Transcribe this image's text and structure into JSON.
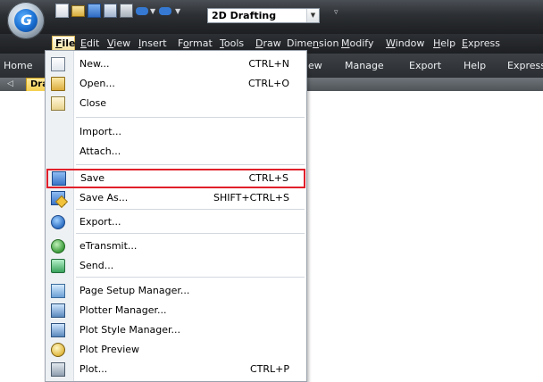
{
  "title_bar": {
    "app_logo": "G",
    "workspace": "2D Drafting"
  },
  "menu_bar": {
    "items": [
      {
        "id": "file",
        "pre": "",
        "u": "F",
        "post": "ile"
      },
      {
        "id": "edit",
        "pre": "",
        "u": "E",
        "post": "dit"
      },
      {
        "id": "view",
        "pre": "",
        "u": "V",
        "post": "iew"
      },
      {
        "id": "insert",
        "pre": "",
        "u": "I",
        "post": "nsert"
      },
      {
        "id": "format",
        "pre": "F",
        "u": "o",
        "post": "rmat"
      },
      {
        "id": "tools",
        "pre": "",
        "u": "T",
        "post": "ools"
      },
      {
        "id": "draw",
        "pre": "",
        "u": "D",
        "post": "raw"
      },
      {
        "id": "dimension",
        "pre": "Dime",
        "u": "n",
        "post": "sion"
      },
      {
        "id": "modify",
        "pre": "",
        "u": "M",
        "post": "odify"
      },
      {
        "id": "window",
        "pre": "",
        "u": "W",
        "post": "indow"
      },
      {
        "id": "help",
        "pre": "",
        "u": "H",
        "post": "elp"
      },
      {
        "id": "express",
        "pre": "",
        "u": "E",
        "post": "xpress"
      }
    ]
  },
  "ribbon_tabs": {
    "home": "Home",
    "view_partial": "ew",
    "manage": "Manage",
    "export": "Export",
    "help": "Help",
    "express": "Express"
  },
  "doc_tabs": {
    "prev": "◁",
    "active": "Dra"
  },
  "file_menu": {
    "items": [
      {
        "label": "New...",
        "shortcut": "CTRL+N",
        "icon": "new-document-icon"
      },
      {
        "label": "Open...",
        "shortcut": "CTRL+O",
        "icon": "open-folder-icon"
      },
      {
        "label": "Close",
        "shortcut": "",
        "icon": "close-folder-icon"
      },
      {
        "label": "Import...",
        "shortcut": "",
        "icon": ""
      },
      {
        "label": "Attach...",
        "shortcut": "",
        "icon": ""
      },
      {
        "label": "Save",
        "shortcut": "CTRL+S",
        "icon": "save-icon",
        "highlighted": true
      },
      {
        "label": "Save As...",
        "shortcut": "SHIFT+CTRL+S",
        "icon": "save-as-icon"
      },
      {
        "label": "Export...",
        "shortcut": "",
        "icon": "export-globe-icon"
      },
      {
        "label": "eTransmit...",
        "shortcut": "",
        "icon": "etransmit-icon"
      },
      {
        "label": "Send...",
        "shortcut": "",
        "icon": "send-icon"
      },
      {
        "label": "Page Setup Manager...",
        "shortcut": "",
        "icon": "page-setup-icon"
      },
      {
        "label": "Plotter Manager...",
        "shortcut": "",
        "icon": "plotter-icon"
      },
      {
        "label": "Plot Style Manager...",
        "shortcut": "",
        "icon": "plot-style-icon"
      },
      {
        "label": "Plot Preview",
        "shortcut": "",
        "icon": "plot-preview-icon"
      },
      {
        "label": "Plot...",
        "shortcut": "CTRL+P",
        "icon": "plot-icon"
      }
    ]
  },
  "colors": {
    "highlight_border": "#e0202a",
    "menu_file_active": "#f6e39a",
    "doc_tab_active": "#f4cf52"
  }
}
